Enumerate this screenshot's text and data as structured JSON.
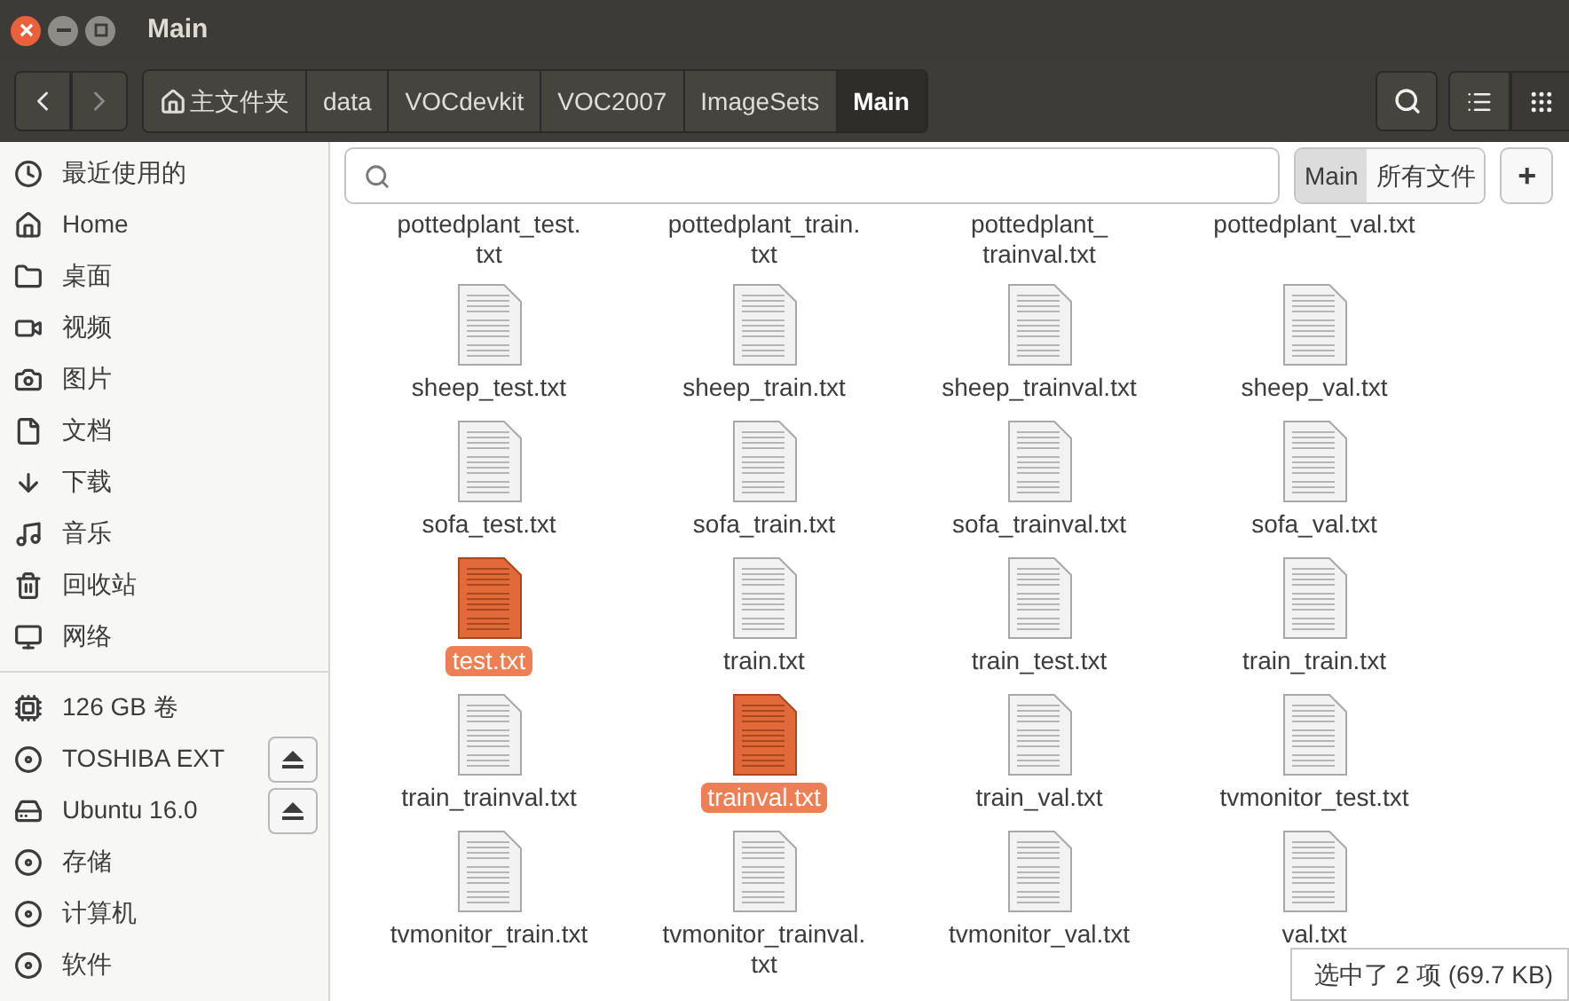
{
  "window": {
    "title": "Main"
  },
  "path": [
    {
      "label": "主文件夹",
      "kind": "home",
      "selected": false
    },
    {
      "label": "data",
      "kind": "folder",
      "selected": false
    },
    {
      "label": "VOCdevkit",
      "kind": "folder",
      "selected": false
    },
    {
      "label": "VOC2007",
      "kind": "folder",
      "selected": false
    },
    {
      "label": "ImageSets",
      "kind": "folder",
      "selected": false
    },
    {
      "label": "Main",
      "kind": "folder",
      "selected": true
    }
  ],
  "sidebar": {
    "places": [
      {
        "label": "最近使用的",
        "kind": "clock"
      },
      {
        "label": "Home",
        "kind": "home"
      },
      {
        "label": "桌面",
        "kind": "folder"
      },
      {
        "label": "视频",
        "kind": "video"
      },
      {
        "label": "图片",
        "kind": "camera"
      },
      {
        "label": "文档",
        "kind": "document"
      },
      {
        "label": "下载",
        "kind": "download"
      },
      {
        "label": "音乐",
        "kind": "music"
      },
      {
        "label": "回收站",
        "kind": "trash"
      },
      {
        "label": "网络",
        "kind": "network"
      }
    ],
    "devices": [
      {
        "label": "126 GB 卷",
        "kind": "chip",
        "eject": false
      },
      {
        "label": "TOSHIBA EXT",
        "kind": "disk",
        "eject": true
      },
      {
        "label": "Ubuntu 16.0",
        "kind": "drive",
        "eject": true
      },
      {
        "label": "存储",
        "kind": "disk",
        "eject": false
      },
      {
        "label": "计算机",
        "kind": "disk",
        "eject": false
      },
      {
        "label": "软件",
        "kind": "disk",
        "eject": false
      }
    ]
  },
  "search": {
    "scopes": [
      {
        "label": "Main",
        "selected": true
      },
      {
        "label": "所有文件",
        "selected": false
      }
    ],
    "add": "+"
  },
  "files_top_row": [
    {
      "lines": [
        "pottedplant_test.",
        "txt"
      ]
    },
    {
      "lines": [
        "pottedplant_train.",
        "txt"
      ]
    },
    {
      "lines": [
        "pottedplant_",
        "trainval.txt"
      ]
    },
    {
      "lines": [
        "pottedplant_val.txt"
      ]
    }
  ],
  "files": [
    {
      "lines": [
        "sheep_test.txt"
      ],
      "selected": false
    },
    {
      "lines": [
        "sheep_train.txt"
      ],
      "selected": false
    },
    {
      "lines": [
        "sheep_trainval.txt"
      ],
      "selected": false
    },
    {
      "lines": [
        "sheep_val.txt"
      ],
      "selected": false
    },
    {
      "lines": [
        "sofa_test.txt"
      ],
      "selected": false
    },
    {
      "lines": [
        "sofa_train.txt"
      ],
      "selected": false
    },
    {
      "lines": [
        "sofa_trainval.txt"
      ],
      "selected": false
    },
    {
      "lines": [
        "sofa_val.txt"
      ],
      "selected": false
    },
    {
      "lines": [
        "test.txt"
      ],
      "selected": true
    },
    {
      "lines": [
        "train.txt"
      ],
      "selected": false
    },
    {
      "lines": [
        "train_test.txt"
      ],
      "selected": false
    },
    {
      "lines": [
        "train_train.txt"
      ],
      "selected": false
    },
    {
      "lines": [
        "train_trainval.txt"
      ],
      "selected": false
    },
    {
      "lines": [
        "trainval.txt"
      ],
      "selected": true
    },
    {
      "lines": [
        "train_val.txt"
      ],
      "selected": false
    },
    {
      "lines": [
        "tvmonitor_test.txt"
      ],
      "selected": false
    },
    {
      "lines": [
        "tvmonitor_train.txt"
      ],
      "selected": false
    },
    {
      "lines": [
        "tvmonitor_trainval.",
        "txt"
      ],
      "selected": false
    },
    {
      "lines": [
        "tvmonitor_val.txt"
      ],
      "selected": false
    },
    {
      "lines": [
        "val.txt"
      ],
      "selected": false
    }
  ],
  "status_bar": "选中了 2 项 (69.7 KB)"
}
